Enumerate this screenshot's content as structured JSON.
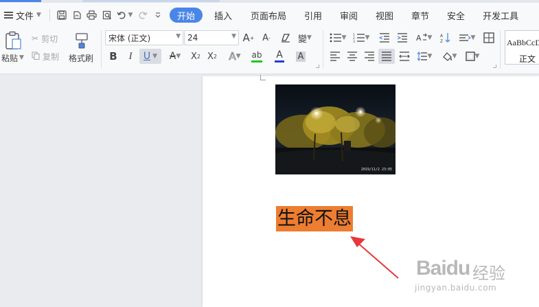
{
  "menu": {
    "file_label": "文件"
  },
  "tabs": [
    {
      "label": "开始",
      "active": true
    },
    {
      "label": "插入"
    },
    {
      "label": "页面布局"
    },
    {
      "label": "引用"
    },
    {
      "label": "审阅"
    },
    {
      "label": "视图"
    },
    {
      "label": "章节"
    },
    {
      "label": "安全"
    },
    {
      "label": "开发工具"
    }
  ],
  "clipboard": {
    "paste_label": "粘贴",
    "cut_label": "剪切",
    "copy_label": "复制",
    "format_painter_label": "格式刷"
  },
  "font": {
    "name": "宋体 (正文)",
    "size": "24"
  },
  "styles": {
    "preview_text": "AaBbCcD",
    "normal_label": "正文"
  },
  "document": {
    "photo_timestamp": "2019/11/2  23:05",
    "highlighted_text": "生命不息",
    "highlight_color": "#ed7d31"
  },
  "annotation": {
    "arrow_color": "#e8363a"
  },
  "watermark": {
    "brand": "Baidu",
    "product": "经验",
    "url": "jingyan.baidu.com"
  },
  "colors": {
    "accent": "#4a86e8",
    "font_color_bar": "#1f3fd8",
    "highlight_bar": "#22c322"
  }
}
